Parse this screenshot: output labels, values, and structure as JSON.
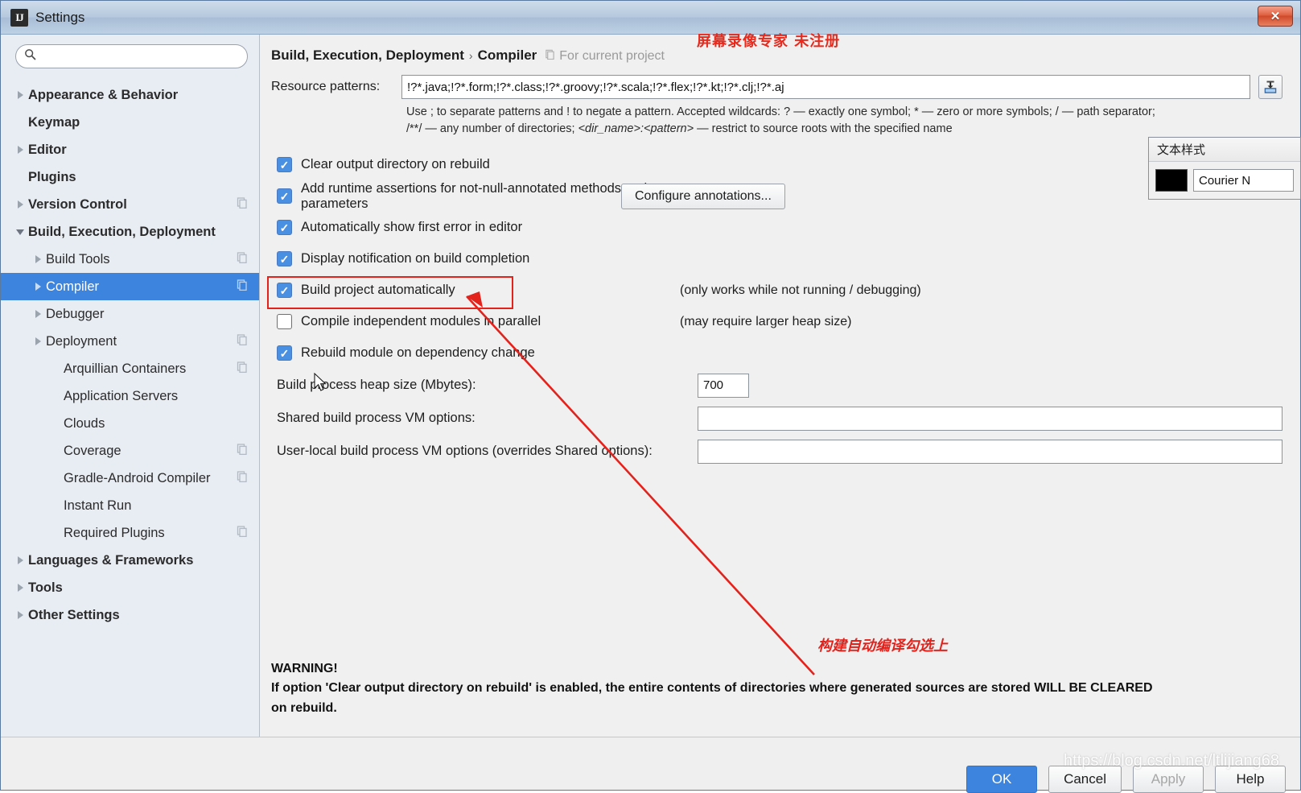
{
  "window": {
    "title": "Settings",
    "app_icon": "intellij-idea-icon",
    "close_label": "✕"
  },
  "sidebar": {
    "search": {
      "value": "",
      "placeholder": "",
      "icon": "search-icon"
    },
    "items": [
      {
        "label": "Appearance & Behavior",
        "arrow": "right",
        "bold": true,
        "indent": 0,
        "project_icon": false,
        "selected": false
      },
      {
        "label": "Keymap",
        "arrow": "none",
        "bold": true,
        "indent": 0,
        "project_icon": false,
        "selected": false
      },
      {
        "label": "Editor",
        "arrow": "right",
        "bold": true,
        "indent": 0,
        "project_icon": false,
        "selected": false
      },
      {
        "label": "Plugins",
        "arrow": "none",
        "bold": true,
        "indent": 0,
        "project_icon": false,
        "selected": false
      },
      {
        "label": "Version Control",
        "arrow": "right",
        "bold": true,
        "indent": 0,
        "project_icon": true,
        "selected": false
      },
      {
        "label": "Build, Execution, Deployment",
        "arrow": "down",
        "bold": true,
        "indent": 0,
        "project_icon": false,
        "selected": false
      },
      {
        "label": "Build Tools",
        "arrow": "right",
        "bold": false,
        "indent": 1,
        "project_icon": true,
        "selected": false
      },
      {
        "label": "Compiler",
        "arrow": "right",
        "bold": false,
        "indent": 1,
        "project_icon": true,
        "selected": true
      },
      {
        "label": "Debugger",
        "arrow": "right",
        "bold": false,
        "indent": 1,
        "project_icon": false,
        "selected": false
      },
      {
        "label": "Deployment",
        "arrow": "right",
        "bold": false,
        "indent": 1,
        "project_icon": true,
        "selected": false
      },
      {
        "label": "Arquillian Containers",
        "arrow": "none",
        "bold": false,
        "indent": 2,
        "project_icon": true,
        "selected": false
      },
      {
        "label": "Application Servers",
        "arrow": "none",
        "bold": false,
        "indent": 2,
        "project_icon": false,
        "selected": false
      },
      {
        "label": "Clouds",
        "arrow": "none",
        "bold": false,
        "indent": 2,
        "project_icon": false,
        "selected": false
      },
      {
        "label": "Coverage",
        "arrow": "none",
        "bold": false,
        "indent": 2,
        "project_icon": true,
        "selected": false
      },
      {
        "label": "Gradle-Android Compiler",
        "arrow": "none",
        "bold": false,
        "indent": 2,
        "project_icon": true,
        "selected": false
      },
      {
        "label": "Instant Run",
        "arrow": "none",
        "bold": false,
        "indent": 2,
        "project_icon": false,
        "selected": false
      },
      {
        "label": "Required Plugins",
        "arrow": "none",
        "bold": false,
        "indent": 2,
        "project_icon": true,
        "selected": false
      },
      {
        "label": "Languages & Frameworks",
        "arrow": "right",
        "bold": true,
        "indent": 0,
        "project_icon": false,
        "selected": false
      },
      {
        "label": "Tools",
        "arrow": "right",
        "bold": true,
        "indent": 0,
        "project_icon": false,
        "selected": false
      },
      {
        "label": "Other Settings",
        "arrow": "right",
        "bold": true,
        "indent": 0,
        "project_icon": false,
        "selected": false
      }
    ]
  },
  "content": {
    "breadcrumb": {
      "part1": "Build, Execution, Deployment",
      "separator": "›",
      "part2": "Compiler"
    },
    "for_current_project": "For current project",
    "resource_patterns": {
      "label": "Resource patterns:",
      "value": "!?*.java;!?*.form;!?*.class;!?*.groovy;!?*.scala;!?*.flex;!?*.kt;!?*.clj;!?*.aj",
      "import_icon": "import-settings-icon"
    },
    "hint_line1": "Use ; to separate patterns and ! to negate a pattern. Accepted wildcards: ? — exactly one symbol; * — zero or more symbols; / — path separator;",
    "hint_line2_a": "/**/ — any number of directories; ",
    "hint_line2_b": "<dir_name>:<pattern>",
    "hint_line2_c": " — restrict to source roots with the specified name",
    "checkboxes": [
      {
        "label": "Clear output directory on rebuild",
        "checked": true,
        "note": ""
      },
      {
        "label": "Add runtime assertions for not-null-annotated methods and parameters",
        "checked": true,
        "note": ""
      },
      {
        "label": "Automatically show first error in editor",
        "checked": true,
        "note": ""
      },
      {
        "label": "Display notification on build completion",
        "checked": true,
        "note": ""
      },
      {
        "label": "Build project automatically",
        "checked": true,
        "note": "(only works while not running / debugging)"
      },
      {
        "label": "Compile independent modules in parallel",
        "checked": false,
        "note": "(may require larger heap size)"
      },
      {
        "label": "Rebuild module on dependency change",
        "checked": true,
        "note": ""
      }
    ],
    "configure_annotations_label": "Configure annotations...",
    "fields": [
      {
        "label": "Build process heap size (Mbytes):",
        "value": "700",
        "name": "heap-size-input"
      },
      {
        "label": "Shared build process VM options:",
        "value": "",
        "name": "shared-vm-options-input"
      },
      {
        "label": "User-local build process VM options (overrides Shared options):",
        "value": "",
        "name": "user-local-vm-options-input"
      }
    ],
    "warning_title": "WARNING!",
    "warning_line1": "If option 'Clear output directory on rebuild' is enabled, the entire contents of directories where generated sources are stored WILL BE CLEARED",
    "warning_line2": "on rebuild."
  },
  "annotations": {
    "recorder_watermark": "屏幕录像专家  未注册",
    "callout_note": "构建自动编译勾选上",
    "highlight_color": "#e4221c",
    "site_watermark": "https://blog.csdn.net/ltlijiang68"
  },
  "text_style_panel": {
    "title": "文本样式",
    "color": "#000000",
    "font_value": "Courier N"
  },
  "footer": {
    "ok": "OK",
    "cancel": "Cancel",
    "apply": "Apply",
    "help": "Help"
  }
}
